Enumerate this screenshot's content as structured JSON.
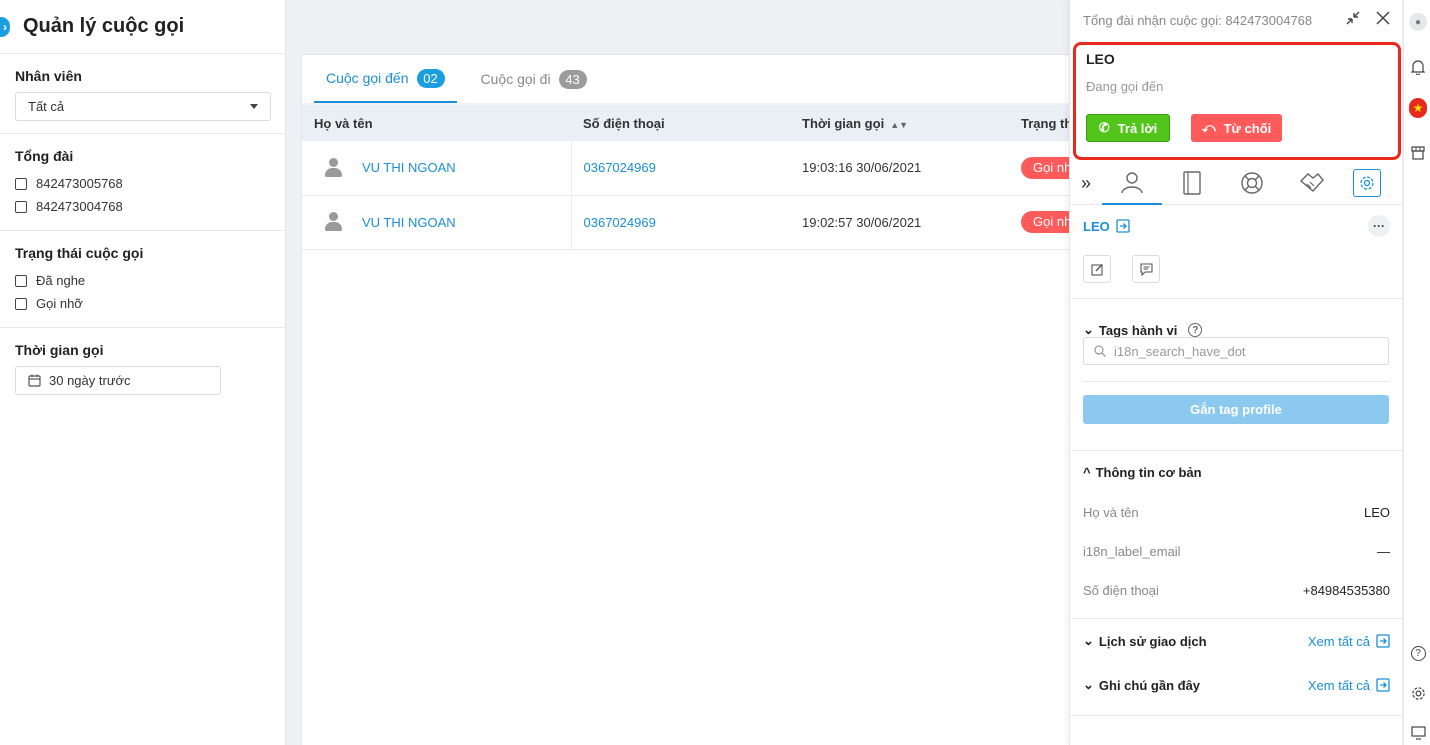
{
  "left": {
    "title": "Quản lý cuộc gọi",
    "employee_label": "Nhân viên",
    "employee_value": "Tất cả",
    "switchboard_label": "Tổng đài",
    "switchboards": [
      "842473005768",
      "842473004768"
    ],
    "call_status_label": "Trạng thái cuộc gọi",
    "call_statuses": [
      "Đã nghe",
      "Gọi nhỡ"
    ],
    "call_time_label": "Thời gian gọi",
    "call_time_value": "30 ngày trước"
  },
  "main": {
    "tabs": [
      {
        "label": "Cuộc gọi đến",
        "count": "02"
      },
      {
        "label": "Cuộc gọi đi",
        "count": "43"
      }
    ],
    "columns": [
      "Họ và tên",
      "Số điện thoại",
      "Thời gian gọi",
      "Trạng thái"
    ],
    "rows": [
      {
        "name": "VU THI NGOAN",
        "phone": "0367024969",
        "time": "19:03:16 30/06/2021",
        "status": "Gọi nhỡ"
      },
      {
        "name": "VU THI NGOAN",
        "phone": "0367024969",
        "time": "19:02:57 30/06/2021",
        "status": "Gọi nhỡ"
      }
    ]
  },
  "call": {
    "header": "Tổng đài nhận cuộc gọi: 842473004768",
    "caller": "LEO",
    "state": "Đang gọi đến",
    "answer_label": "Trả lời",
    "reject_label": "Từ chối",
    "profile_name": "LEO",
    "tags_title": "Tags hành vi",
    "tags_placeholder": "i18n_search_have_dot",
    "attach_label": "Gắn tag profile",
    "basic_info_title": "Thông tin cơ bản",
    "info": [
      {
        "key": "Họ và tên",
        "value": "LEO"
      },
      {
        "key": "i18n_label_email",
        "value": "—"
      },
      {
        "key": "Số điện thoại",
        "value": "+84984535380"
      }
    ],
    "history_title": "Lịch sử giao dịch",
    "notes_title": "Ghi chú gần đây",
    "view_all": "Xem tất cả"
  },
  "colors": {
    "accent": "#1a8ed6",
    "missed": "#ff5b5b",
    "answer": "#52c41a",
    "highlight": "#e8291c"
  }
}
